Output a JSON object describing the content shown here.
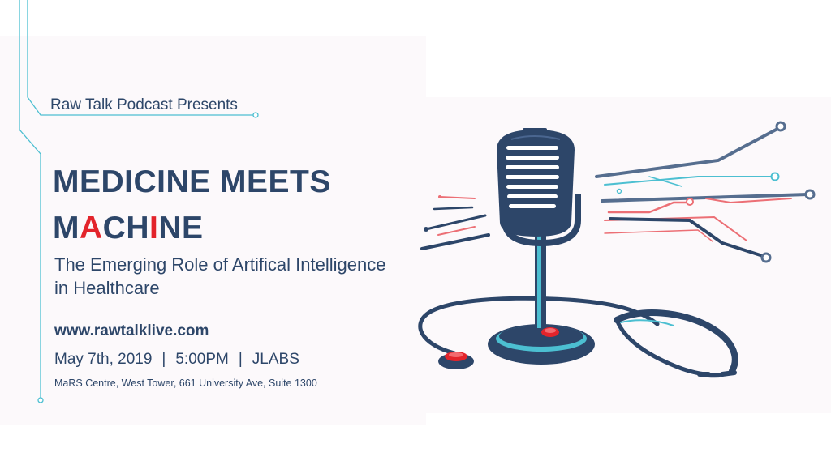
{
  "presenter": "Raw Talk Podcast Presents",
  "title": {
    "line1": "MEDICINE MEETS",
    "line2_parts": [
      "M",
      "A",
      "CH",
      "I",
      "NE"
    ]
  },
  "subtitle": "The Emerging Role of Artifical Intelligence in Healthcare",
  "website": "www.rawtalklive.com",
  "event": {
    "date": "May 7th, 2019",
    "separator": "|",
    "time": "5:00PM",
    "venue": "JLABS"
  },
  "address": "MaRS Centre, West Tower, 661 University Ave, Suite 1300",
  "colors": {
    "navy": "#2d4669",
    "red": "#e3242b",
    "coral": "#ec6f75",
    "teal": "#4cbfd1",
    "background": "#fcf9fb"
  },
  "icons": [
    "microphone-icon",
    "stethoscope-icon",
    "circuit-lines-icon"
  ]
}
